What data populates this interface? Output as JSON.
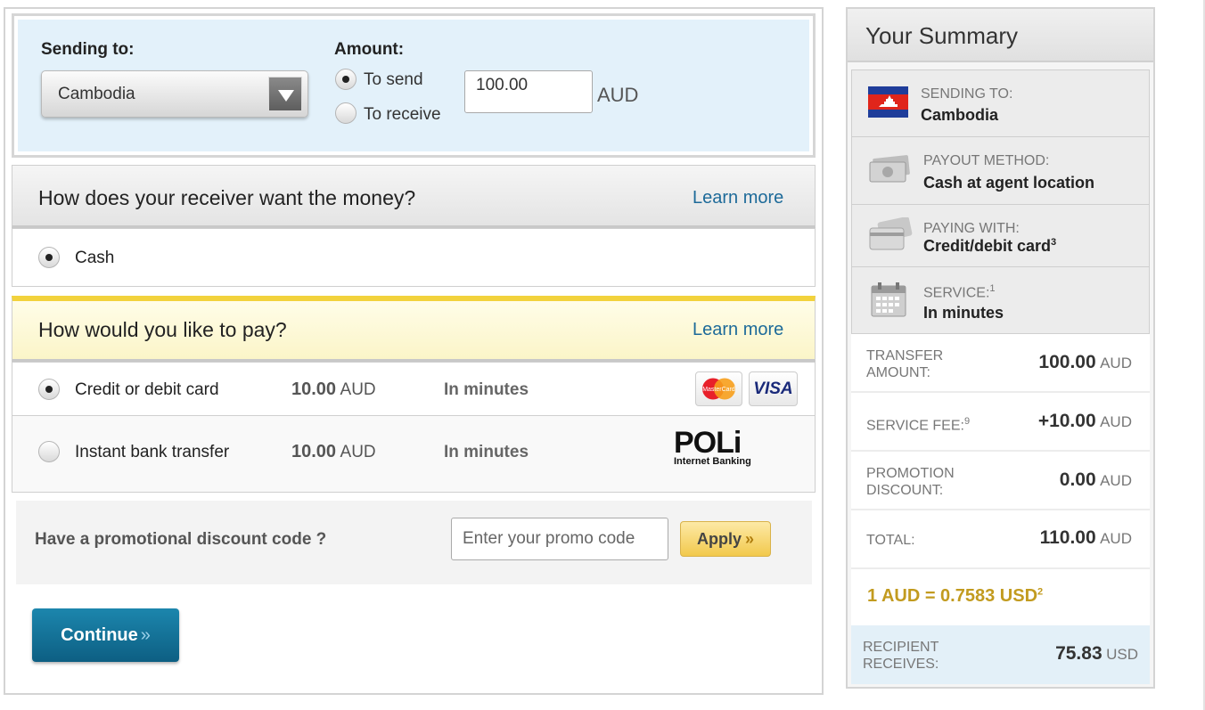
{
  "amount_panel": {
    "sending_to_label": "Sending to:",
    "country": "Cambodia",
    "amount_label": "Amount:",
    "to_send_label": "To send",
    "to_receive_label": "To receive",
    "amount_value": "100.00",
    "currency": "AUD"
  },
  "receiver_section": {
    "title": "How does your receiver want the money?",
    "learn_more": "Learn more",
    "options": [
      {
        "label": "Cash",
        "selected": true
      }
    ]
  },
  "pay_section": {
    "title": "How would you like to pay?",
    "learn_more": "Learn more",
    "options": [
      {
        "label": "Credit or debit card",
        "fee": "10.00",
        "currency": "AUD",
        "speed": "In minutes",
        "selected": true,
        "logos": [
          "MasterCard",
          "VISA"
        ]
      },
      {
        "label": "Instant bank transfer",
        "fee": "10.00",
        "currency": "AUD",
        "speed": "In minutes",
        "selected": false,
        "logo_main": "POLi",
        "logo_sub": "Internet Banking"
      }
    ]
  },
  "promo": {
    "label": "Have a promotional discount code ?",
    "placeholder": "Enter your promo code",
    "apply_label": "Apply",
    "apply_chevron": "»"
  },
  "continue_button": {
    "label": "Continue",
    "chevron": "»"
  },
  "summary": {
    "title": "Your Summary",
    "sending_to": {
      "label": "SENDING TO:",
      "value": "Cambodia"
    },
    "payout_method": {
      "label": "PAYOUT METHOD:",
      "value": "Cash at agent location"
    },
    "paying_with": {
      "label": "PAYING WITH:",
      "value": "Credit/debit card",
      "sup": "3"
    },
    "service": {
      "label": "SERVICE:",
      "sup": "1",
      "value": "In minutes"
    },
    "transfer_amount": {
      "label_line1": "TRANSFER",
      "label_line2": "AMOUNT:",
      "value": "100.00",
      "currency": "AUD"
    },
    "service_fee": {
      "label": "SERVICE FEE:",
      "sup": "9",
      "value": "+10.00",
      "currency": "AUD"
    },
    "promotion_discount": {
      "label_line1": "PROMOTION",
      "label_line2": "DISCOUNT:",
      "value": "0.00",
      "currency": "AUD"
    },
    "total": {
      "label": "TOTAL:",
      "value": "110.00",
      "currency": "AUD"
    },
    "exchange_rate": "1 AUD = 0.7583 USD",
    "exchange_rate_sup": "2",
    "recipient_receives": {
      "label_line1": "RECIPIENT",
      "label_line2": "RECEIVES:",
      "value": "75.83",
      "currency": "USD"
    }
  },
  "colors": {
    "link_blue": "#1d6a99",
    "continue_blue": "#0d6f96",
    "apply_yellow": "#f2c94c",
    "rate_gold": "#c29b1f",
    "pay_header_accent": "#f2d23c"
  }
}
